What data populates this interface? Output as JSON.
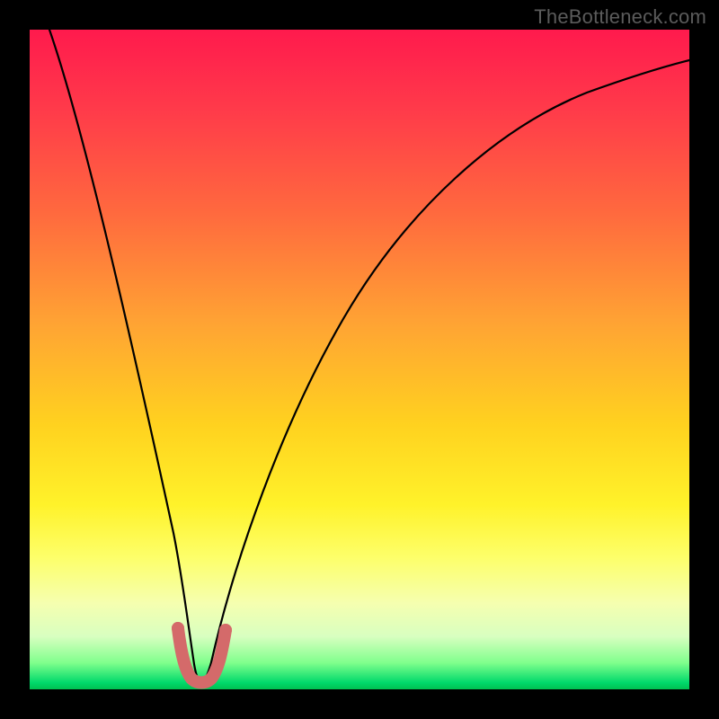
{
  "watermark": "TheBottleneck.com",
  "chart_data": {
    "type": "line",
    "title": "",
    "xlabel": "",
    "ylabel": "",
    "xlim": [
      0,
      100
    ],
    "ylim": [
      0,
      100
    ],
    "grid": false,
    "legend": false,
    "series": [
      {
        "name": "bottleneck-curve",
        "color": "#000000",
        "x": [
          3,
          5,
          8,
          10,
          12,
          14,
          16,
          18,
          20,
          22,
          23,
          24,
          25,
          26,
          27,
          28,
          30,
          33,
          36,
          40,
          45,
          50,
          55,
          60,
          65,
          70,
          75,
          80,
          85,
          90,
          95,
          99
        ],
        "values": [
          100,
          92,
          80,
          72,
          63,
          55,
          47,
          38,
          28,
          16,
          10,
          5,
          2,
          2,
          5,
          9,
          16,
          24,
          31,
          39,
          48,
          55,
          61,
          66,
          71,
          75,
          78,
          82,
          85,
          88,
          91,
          93
        ]
      },
      {
        "name": "optimal-zone-marker",
        "color": "#d46a6a",
        "x": [
          21.5,
          22,
          22.5,
          23,
          23.7,
          24.5,
          25.2,
          26,
          26.7,
          27.3,
          28,
          28.5,
          29
        ],
        "values": [
          10,
          8,
          6,
          4.5,
          3,
          2.2,
          2.2,
          3,
          4.5,
          6,
          8,
          10,
          12
        ]
      }
    ],
    "annotations": []
  }
}
